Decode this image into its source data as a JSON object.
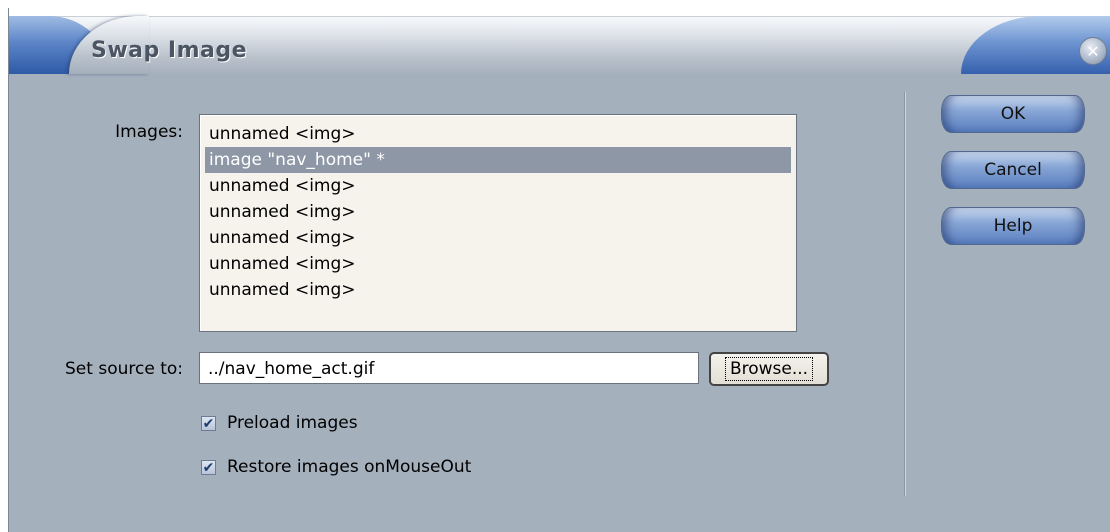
{
  "dialog": {
    "title": "Swap Image",
    "close_icon": "close-icon"
  },
  "form": {
    "images_label": "Images:",
    "images": [
      {
        "label": "unnamed <img>",
        "selected": false
      },
      {
        "label": "image \"nav_home\" *",
        "selected": true
      },
      {
        "label": "unnamed <img>",
        "selected": false
      },
      {
        "label": "unnamed <img>",
        "selected": false
      },
      {
        "label": "unnamed <img>",
        "selected": false
      },
      {
        "label": "unnamed <img>",
        "selected": false
      },
      {
        "label": "unnamed <img>",
        "selected": false
      }
    ],
    "source_label": "Set source to:",
    "source_value": "../nav_home_act.gif",
    "browse_label": "Browse...",
    "preload_label": "Preload images",
    "preload_checked": true,
    "restore_label": "Restore images onMouseOut",
    "restore_checked": true
  },
  "buttons": {
    "ok": "OK",
    "cancel": "Cancel",
    "help": "Help"
  },
  "colors": {
    "dialog_bg": "#a5b0bd",
    "selection": "#8e97a6",
    "accent_blue": "#5d86c8"
  }
}
